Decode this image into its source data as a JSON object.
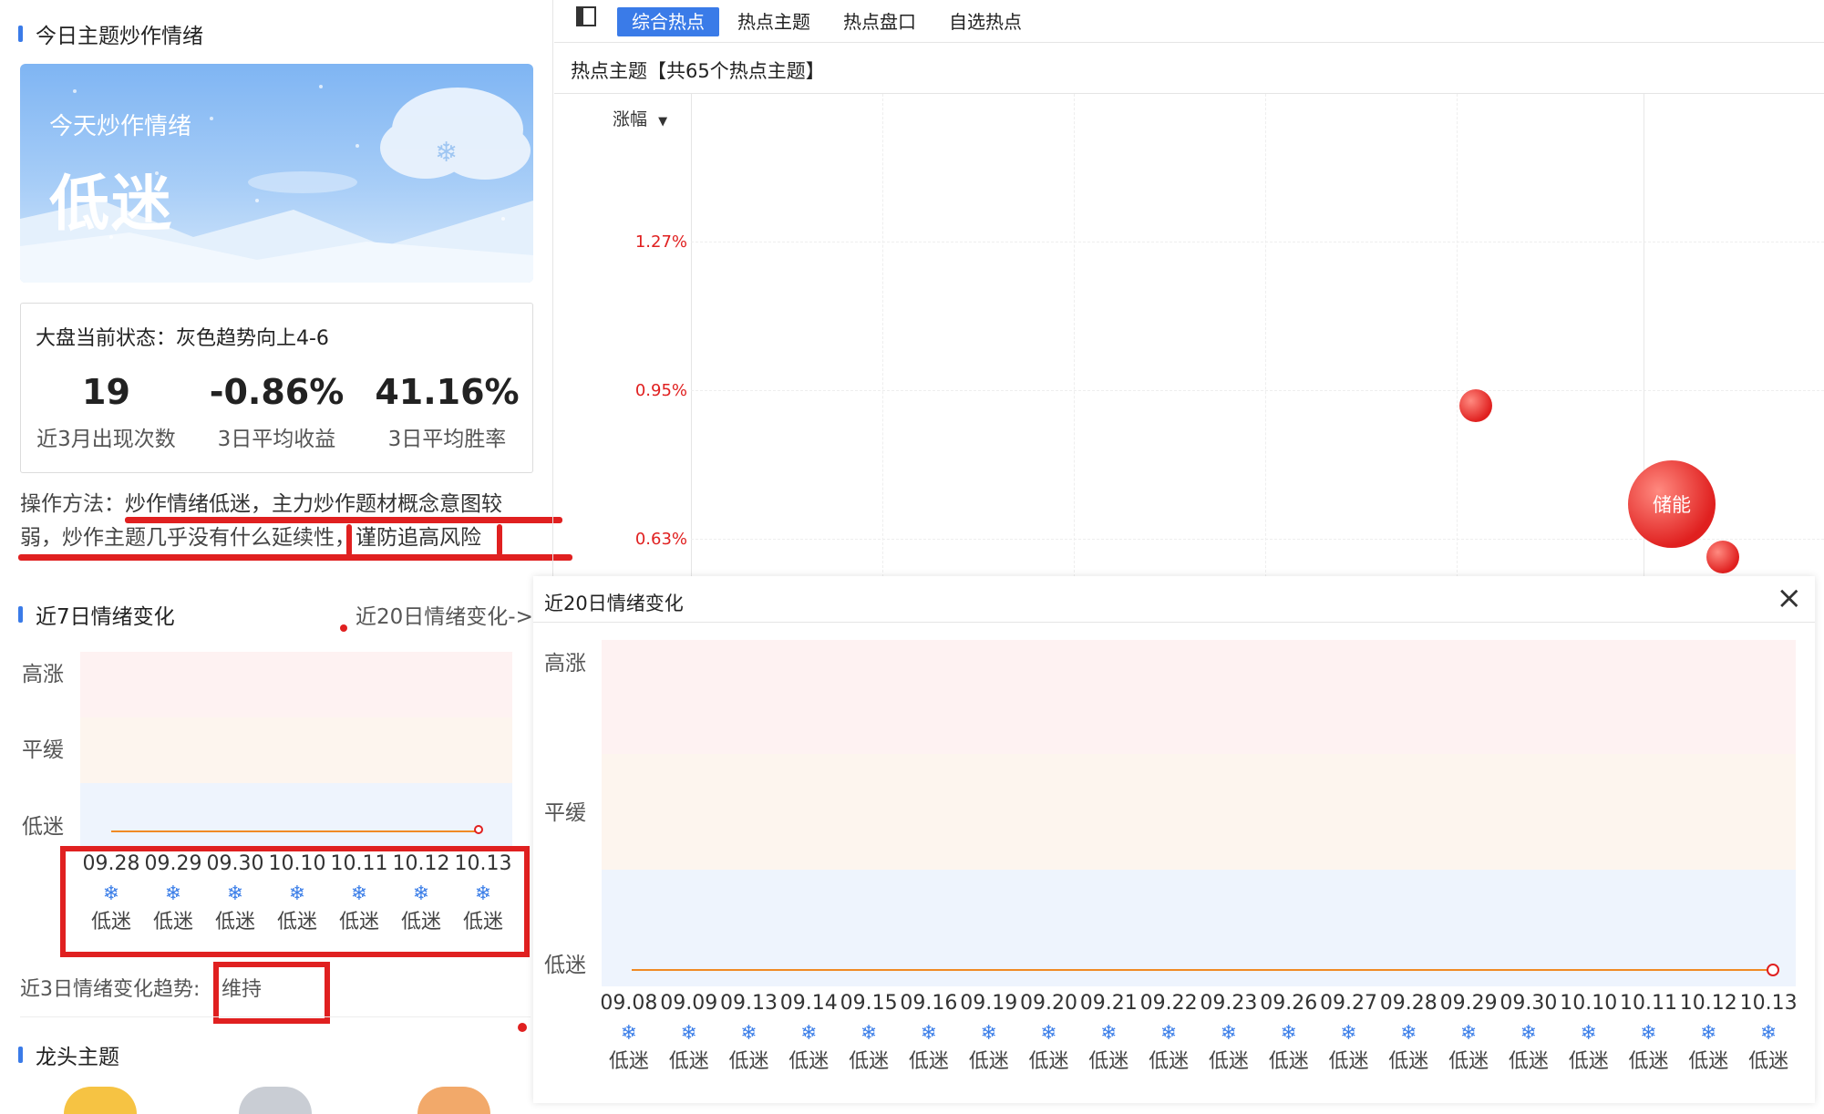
{
  "left": {
    "title": "今日主题炒作情绪",
    "hero": {
      "sub": "今天炒作情绪",
      "main": "低迷"
    },
    "card": {
      "status": "大盘当前状态：灰色趋势向上4-6",
      "stats": [
        {
          "value": "19",
          "label": "近3月出现次数"
        },
        {
          "value": "-0.86%",
          "label": "3日平均收益"
        },
        {
          "value": "41.16%",
          "label": "3日平均胜率"
        }
      ]
    },
    "ops": {
      "prefix": "操作方法：",
      "text1": "炒作情绪低迷，主力炒作题材概念意图较",
      "text2": "弱，炒作主题几乎没有什么延续性，",
      "warn": "谨防追高风险"
    },
    "week": {
      "title": "近7日情绪变化",
      "link": "近20日情绪变化->",
      "levels": [
        "高涨",
        "平缓",
        "低迷"
      ],
      "dates": [
        "09.28",
        "09.29",
        "09.30",
        "10.10",
        "10.11",
        "10.12",
        "10.13"
      ],
      "states": [
        "低迷",
        "低迷",
        "低迷",
        "低迷",
        "低迷",
        "低迷",
        "低迷"
      ],
      "trend_label": "近3日情绪变化趋势:",
      "trend_value": "维持"
    },
    "leader_title": "龙头主题"
  },
  "tabs": [
    "综合热点",
    "热点主题",
    "热点盘口",
    "自选热点"
  ],
  "active_tab": 0,
  "hot": {
    "header": "热点主题【共65个热点主题】",
    "sort_label": "涨幅",
    "y_ticks": [
      "1.27%",
      "0.95%",
      "0.63%"
    ],
    "bubble_label": "储能"
  },
  "popup": {
    "title": "近20日情绪变化",
    "close": "×",
    "levels": [
      "高涨",
      "平缓",
      "低迷"
    ],
    "dates": [
      "09.08",
      "09.09",
      "09.13",
      "09.14",
      "09.15",
      "09.16",
      "09.19",
      "09.20",
      "09.21",
      "09.22",
      "09.23",
      "09.26",
      "09.27",
      "09.28",
      "09.29",
      "09.30",
      "10.10",
      "10.11",
      "10.12",
      "10.13"
    ],
    "states": [
      "低迷",
      "低迷",
      "低迷",
      "低迷",
      "低迷",
      "低迷",
      "低迷",
      "低迷",
      "低迷",
      "低迷",
      "低迷",
      "低迷",
      "低迷",
      "低迷",
      "低迷",
      "低迷",
      "低迷",
      "低迷",
      "低迷",
      "低迷"
    ]
  },
  "colors": {
    "accent": "#3a7be8",
    "red": "#e02020",
    "line": "#f08a24",
    "snow": "#3b7ee8"
  }
}
